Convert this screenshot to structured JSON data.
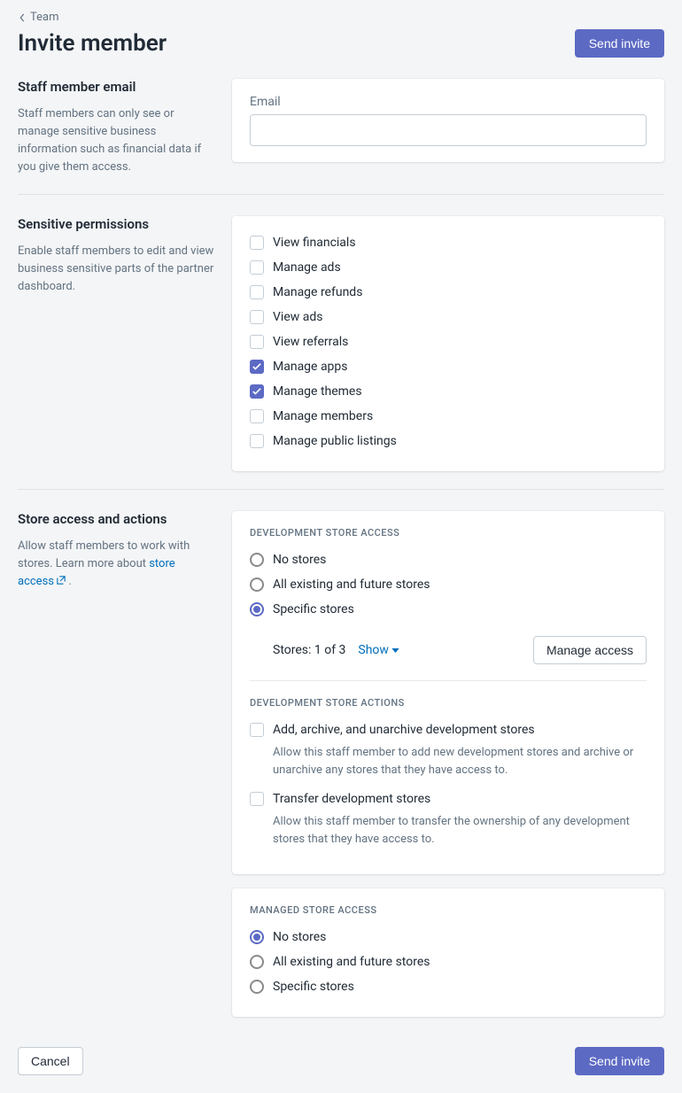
{
  "breadcrumb": {
    "label": "Team"
  },
  "header": {
    "title": "Invite member",
    "send_invite": "Send invite"
  },
  "email_section": {
    "title": "Staff member email",
    "desc": "Staff members can only see or manage sensitive business information such as financial data if you give them access.",
    "field_label": "Email",
    "value": ""
  },
  "permissions_section": {
    "title": "Sensitive permissions",
    "desc": "Enable staff members to edit and view business sensitive parts of the partner dashboard.",
    "items": [
      {
        "label": "View financials",
        "checked": false
      },
      {
        "label": "Manage ads",
        "checked": false
      },
      {
        "label": "Manage refunds",
        "checked": false
      },
      {
        "label": "View ads",
        "checked": false
      },
      {
        "label": "View referrals",
        "checked": false
      },
      {
        "label": "Manage apps",
        "checked": true
      },
      {
        "label": "Manage themes",
        "checked": true
      },
      {
        "label": "Manage members",
        "checked": false
      },
      {
        "label": "Manage public listings",
        "checked": false
      }
    ]
  },
  "store_section": {
    "title": "Store access and actions",
    "desc_prefix": "Allow staff members to work with stores. Learn more about ",
    "desc_link": "store access",
    "desc_suffix": " .",
    "dev_access": {
      "heading": "Development store access",
      "options": [
        {
          "label": "No stores",
          "selected": false
        },
        {
          "label": "All existing and future stores",
          "selected": false
        },
        {
          "label": "Specific stores",
          "selected": true
        }
      ],
      "stores_text": "Stores: 1 of 3",
      "show_label": "Show",
      "manage_access": "Manage access"
    },
    "dev_actions": {
      "heading": "Development store actions",
      "items": [
        {
          "label": "Add, archive, and unarchive development stores",
          "desc": "Allow this staff member to add new development stores and archive or unarchive any stores that they have access to.",
          "checked": false
        },
        {
          "label": "Transfer development stores",
          "desc": "Allow this staff member to transfer the ownership of any development stores that they have access to.",
          "checked": false
        }
      ]
    },
    "managed_access": {
      "heading": "Managed store access",
      "options": [
        {
          "label": "No stores",
          "selected": true
        },
        {
          "label": "All existing and future stores",
          "selected": false
        },
        {
          "label": "Specific stores",
          "selected": false
        }
      ]
    }
  },
  "footer": {
    "cancel": "Cancel",
    "send_invite": "Send invite"
  }
}
